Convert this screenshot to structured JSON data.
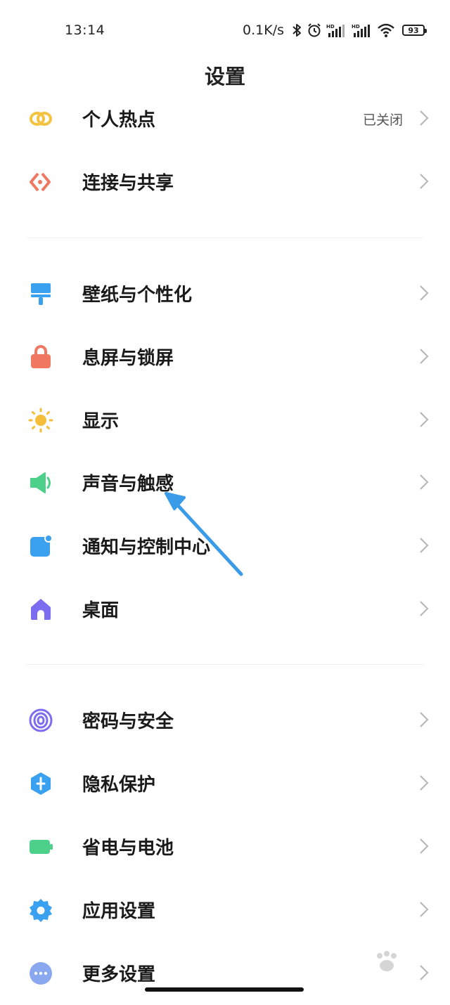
{
  "status_bar": {
    "time": "13:14",
    "net_speed": "0.1K/s",
    "battery": "93",
    "icons": [
      "bluetooth-icon",
      "alarm-icon",
      "signal-hd-1-icon",
      "signal-hd-2-icon",
      "wifi-icon",
      "battery-icon"
    ]
  },
  "header": {
    "title": "设置"
  },
  "sections": [
    {
      "items": [
        {
          "label": "个人热点",
          "value": "已关闭",
          "icon": "hotspot-icon",
          "color": "#F5C342"
        },
        {
          "label": "连接与共享",
          "icon": "connection-sharing-icon",
          "color": "#F07860"
        }
      ]
    },
    {
      "items": [
        {
          "label": "壁纸与个性化",
          "icon": "wallpaper-brush-icon",
          "color": "#3AA0F0"
        },
        {
          "label": "息屏与锁屏",
          "icon": "lock-icon",
          "color": "#F07860"
        },
        {
          "label": "显示",
          "icon": "sun-icon",
          "color": "#F5BE3A"
        },
        {
          "label": "声音与触感",
          "icon": "speaker-icon",
          "color": "#4CD08A"
        },
        {
          "label": "通知与控制中心",
          "icon": "notification-icon",
          "color": "#3AA0F0"
        },
        {
          "label": "桌面",
          "icon": "home-icon",
          "color": "#7B6CF0"
        }
      ]
    },
    {
      "items": [
        {
          "label": "密码与安全",
          "icon": "fingerprint-icon",
          "color": "#7B6CF0"
        },
        {
          "label": "隐私保护",
          "icon": "privacy-shield-icon",
          "color": "#3AA0F0"
        },
        {
          "label": "省电与电池",
          "icon": "battery-saver-icon",
          "color": "#4CD08A"
        },
        {
          "label": "应用设置",
          "icon": "gear-icon",
          "color": "#3AA0F0"
        },
        {
          "label": "更多设置",
          "icon": "more-dots-icon",
          "color": "#8AA8F0"
        }
      ]
    }
  ],
  "annotation": {
    "arrow_color": "#3A9BE8",
    "target": "声音与触感"
  }
}
